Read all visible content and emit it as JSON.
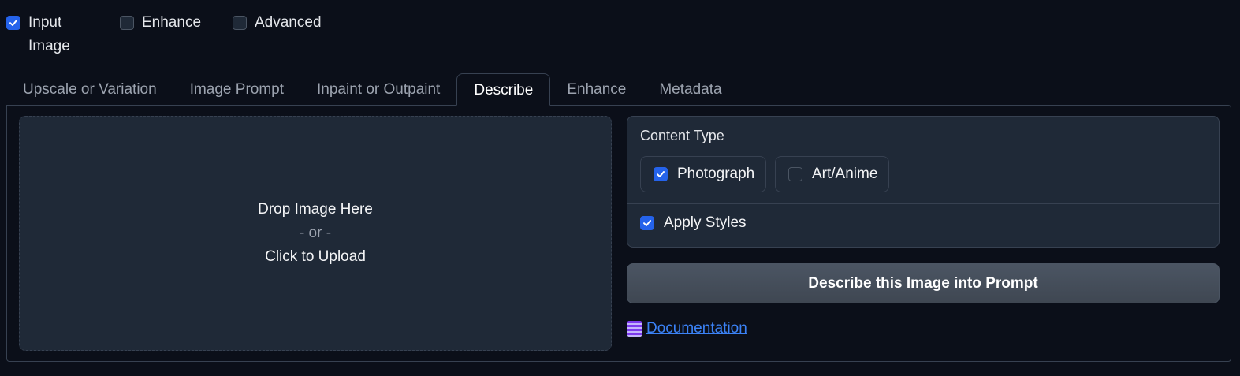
{
  "top_toggles": [
    {
      "label": "Input Image",
      "checked": true
    },
    {
      "label": "Enhance",
      "checked": false
    },
    {
      "label": "Advanced",
      "checked": false
    }
  ],
  "tabs": [
    {
      "label": "Upscale or Variation"
    },
    {
      "label": "Image Prompt"
    },
    {
      "label": "Inpaint or Outpaint"
    },
    {
      "label": "Describe",
      "active": true
    },
    {
      "label": "Enhance"
    },
    {
      "label": "Metadata"
    }
  ],
  "dropzone": {
    "line1": "Drop Image Here",
    "line2": "- or -",
    "line3": "Click to Upload"
  },
  "content_type": {
    "label": "Content Type",
    "options": [
      {
        "label": "Photograph",
        "checked": true
      },
      {
        "label": "Art/Anime",
        "checked": false
      }
    ]
  },
  "apply_styles": {
    "label": "Apply Styles",
    "checked": true
  },
  "describe_button": "Describe this Image into Prompt",
  "documentation": {
    "icon": "book-icon",
    "label": "Documentation"
  },
  "colors": {
    "accent": "#2563eb",
    "link": "#3b82f6",
    "background": "#0b0f19",
    "panel": "#1f2937"
  }
}
